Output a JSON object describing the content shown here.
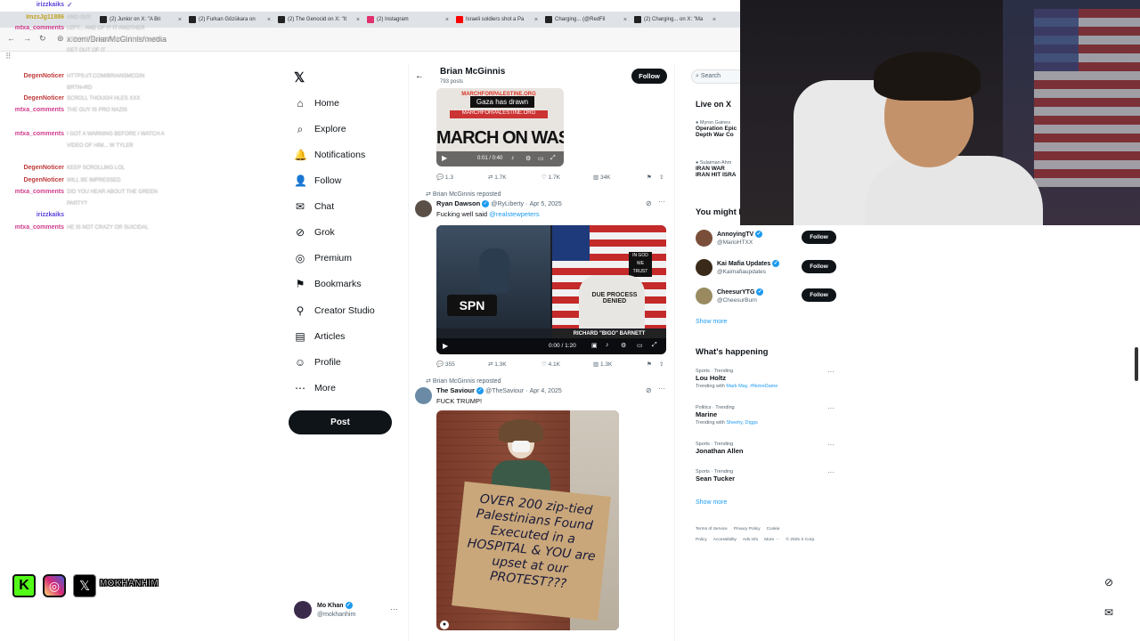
{
  "browser": {
    "tabs": [
      {
        "label": "(2) Junior on X: \"A Bri",
        "color": "#222"
      },
      {
        "label": "(2) Furkan Gözükara on",
        "color": "#222"
      },
      {
        "label": "(2) The Genocid on X: \"It",
        "color": "#222"
      },
      {
        "label": "(2) Instagram",
        "color": "#e1306c"
      },
      {
        "label": "Israeli soldiers shot a Pa",
        "color": "#ff0000"
      },
      {
        "label": "Charging... (@RedFil",
        "color": "#222"
      },
      {
        "label": "(2) Charging... on X: \"Ma",
        "color": "#222"
      }
    ],
    "url": "x.com/BrianMcGinnis/media"
  },
  "chat": [
    {
      "user": "irizzkaiks",
      "user_color": "#5b3fd6",
      "text": "",
      "badge": "✓"
    },
    {
      "user": "ImzsJg11886",
      "user_color": "#c0a020",
      "text": "And ouy"
    },
    {
      "user": "mtxa_comments",
      "user_color": "#d03c8c",
      "text": "LEFT... AND OF IT IT ANOTHER STRAWS HA USA HAS & THEY CAN'T GET OUT OF IT"
    },
    {
      "user": "DegenNoticer",
      "user_color": "#c03a3a",
      "text": "https://t.com/briansmcgin brTN=RD"
    },
    {
      "user": "DegenNoticer",
      "user_color": "#c03a3a",
      "text": "scroll though hles xxx"
    },
    {
      "user": "mtxa_comments",
      "user_color": "#d03c8c",
      "text": "THE GUY IS PRO NAZIS"
    },
    {
      "user": "mtxa_comments",
      "user_color": "#d03c8c",
      "text": "I GOT A WARNING BEFORE I WATCH A VIDEO OF HIM... W TYLER"
    },
    {
      "user": "DegenNoticer",
      "user_color": "#c03a3a",
      "text": "keep scrolling lol"
    },
    {
      "user": "DegenNoticer",
      "user_color": "#c03a3a",
      "text": "will be impressed"
    },
    {
      "user": "mtxa_comments",
      "user_color": "#d03c8c",
      "text": "DID YOU HEAR ABOUT THE GREEN PARTY?"
    },
    {
      "user": "irizzkaiks",
      "user_color": "#5b3fd6",
      "text": ""
    },
    {
      "user": "mtxa_comments",
      "user_color": "#d03c8c",
      "text": "HE IS NOT CRAZY OR SUICIDAL"
    }
  ],
  "social": {
    "handle": "MOKHANHIM"
  },
  "nav": {
    "items": [
      {
        "label": "Home",
        "icon": "⌂",
        "name": "home"
      },
      {
        "label": "Explore",
        "icon": "⌕",
        "name": "explore"
      },
      {
        "label": "Notifications",
        "icon": "🔔",
        "name": "notifications"
      },
      {
        "label": "Follow",
        "icon": "👤",
        "name": "follow"
      },
      {
        "label": "Chat",
        "icon": "✉",
        "name": "chat"
      },
      {
        "label": "Grok",
        "icon": "⊘",
        "name": "grok"
      },
      {
        "label": "Premium",
        "icon": "◎",
        "name": "premium"
      },
      {
        "label": "Bookmarks",
        "icon": "⚑",
        "name": "bookmarks"
      },
      {
        "label": "Creator Studio",
        "icon": "⚲",
        "name": "creator-studio"
      },
      {
        "label": "Articles",
        "icon": "▤",
        "name": "articles"
      },
      {
        "label": "Profile",
        "icon": "☺",
        "name": "profile"
      },
      {
        "label": "More",
        "icon": "⋯",
        "name": "more"
      }
    ],
    "post_label": "Post",
    "account": {
      "name": "Mo Khan",
      "handle": "@mokhanhim"
    }
  },
  "profile_header": {
    "name": "Brian McGinnis",
    "posts": "793 posts",
    "follow_label": "Follow"
  },
  "tweet1": {
    "video_caption": "Gaza has drawn",
    "video_time": "0:01 / 0:40",
    "replies": "1.3",
    "reposts": "1.7K",
    "likes": "1.7K",
    "views": "34K"
  },
  "tweet2": {
    "reposted_by": "Brian McGinnis reposted",
    "author": "Ryan Dawson",
    "handle": "@RyLiberty",
    "date": "Apr 5, 2025",
    "text": "Fucking well said",
    "mention": "@realstewpeters",
    "video_time": "0:00 / 1:20",
    "replies": "355",
    "reposts": "1.3K",
    "likes": "4.1K",
    "views": "1.3K",
    "sign_text": "DUE PROCESS DENIED",
    "lower_third": "RICHARD \"BIGO\" BARNETT"
  },
  "tweet3": {
    "reposted_by": "Brian McGinnis reposted",
    "author": "The Saviour",
    "handle": "@TheSaviour",
    "date": "Apr 4, 2025",
    "text": "FUCK TRUMP!",
    "sign_text": "OVER 200 zip-tied Palestinians Found Executed in a HOSPITAL & YOU are upset at our PROTEST???"
  },
  "right": {
    "search_placeholder": "Search",
    "live_title": "Live on X",
    "live_items": [
      {
        "host": "Myron Gaines",
        "title": "Operation Epic",
        "sub": "Depth War Co"
      },
      {
        "host": "Sulaiman Ahm",
        "title": "IRAN WAR",
        "sub": "IRAN HIT ISRA"
      }
    ],
    "wtf_title": "You might like",
    "wtf": [
      {
        "name": "AnnoyingTV",
        "handle": "@MarioHTXX",
        "avatar": "#7a4f3a"
      },
      {
        "name": "Kai Mafia Updates",
        "handle": "@Kaimafiaupdates",
        "avatar": "#3a2a1a"
      },
      {
        "name": "CheesurYTG",
        "handle": "@CheesurBurn",
        "avatar": "#9a8a60"
      }
    ],
    "follow_label": "Follow",
    "show_more": "Show more",
    "happening_title": "What's happening",
    "trends": [
      {
        "category": "Sports · Trending",
        "name": "Lou Holtz",
        "with": "Trending with",
        "links": "Mark May, #NotreDame"
      },
      {
        "category": "Politics · Trending",
        "name": "Marine",
        "with": "Trending with",
        "links": "Sheehy, Diggs"
      },
      {
        "category": "Sports · Trending",
        "name": "Jonathan Allen",
        "with": "",
        "links": ""
      },
      {
        "category": "Sports · Trending",
        "name": "Sean Tucker",
        "with": "",
        "links": ""
      }
    ],
    "footer": [
      "Terms of Service",
      "Privacy Policy",
      "Cookie Policy",
      "Accessibility",
      "Ads info",
      "More ···",
      "© 2025 X Corp."
    ]
  }
}
